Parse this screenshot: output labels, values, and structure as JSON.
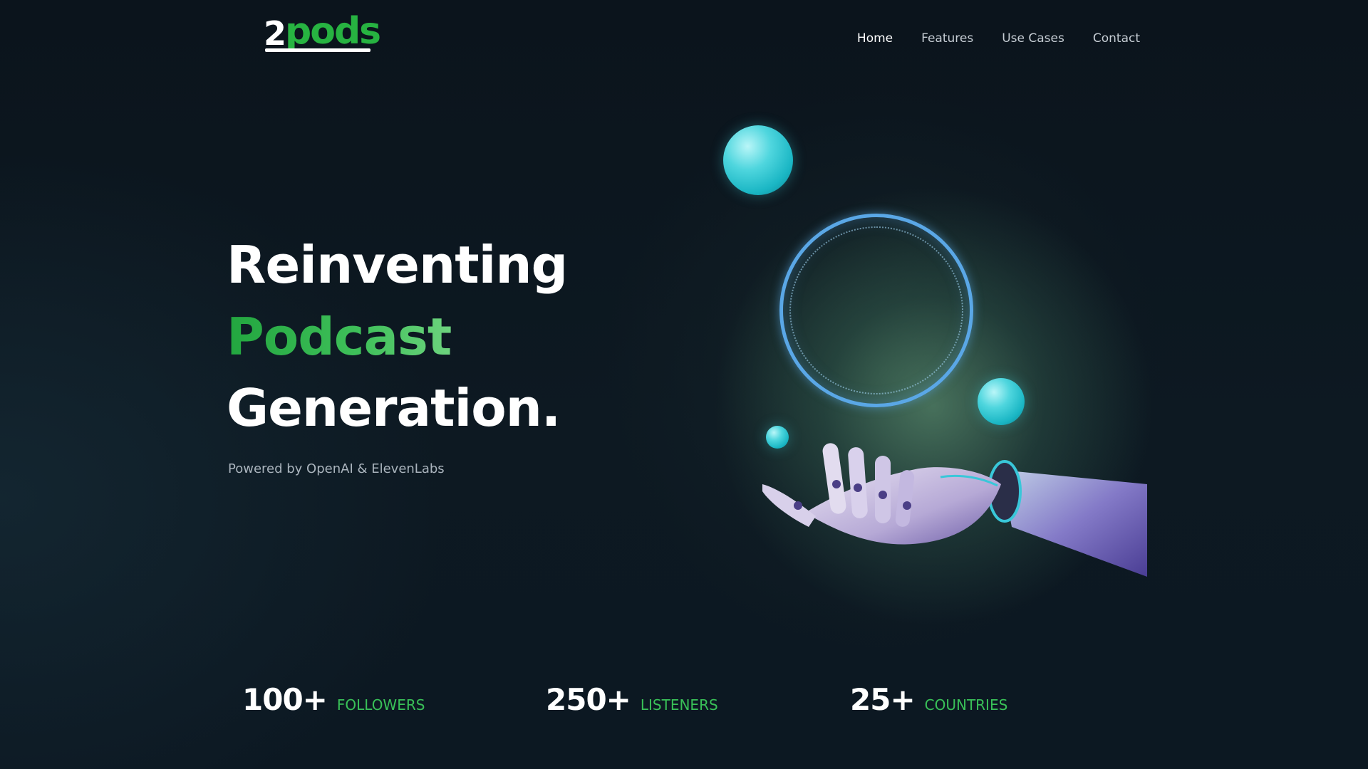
{
  "logo": {
    "prefix": "2",
    "name": "pods"
  },
  "nav": {
    "items": [
      {
        "label": "Home",
        "active": true
      },
      {
        "label": "Features",
        "active": false
      },
      {
        "label": "Use Cases",
        "active": false
      },
      {
        "label": "Contact",
        "active": false
      }
    ]
  },
  "hero": {
    "line1": "Reinventing",
    "line2": "Podcast",
    "line3": "Generation.",
    "subtitle": "Powered by OpenAI & ElevenLabs"
  },
  "stats": [
    {
      "value": "100+",
      "label": "FOLLOWERS"
    },
    {
      "value": "250+",
      "label": "LISTENERS"
    },
    {
      "value": "25+",
      "label": "COUNTRIES"
    }
  ],
  "colors": {
    "background": "#0b131c",
    "accent_green": "#2bb04a",
    "sphere_cyan": "#4fd6de",
    "ring_blue": "#5aa7e6"
  }
}
